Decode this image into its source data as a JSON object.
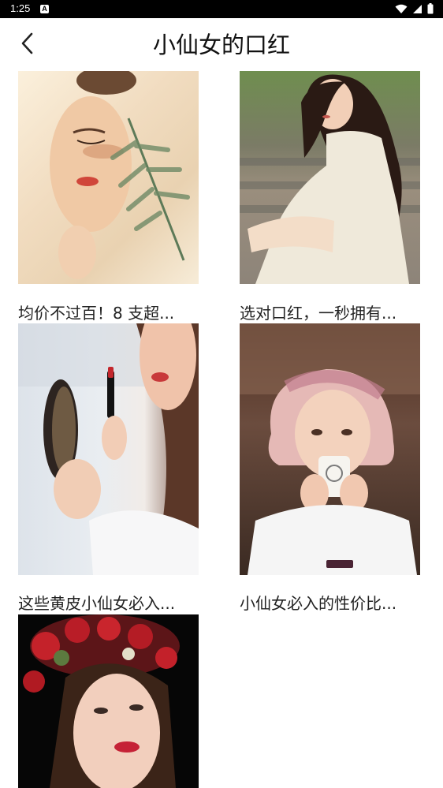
{
  "status_bar": {
    "time": "1:25",
    "notification_icon": "a-letter-icon",
    "icons": [
      "wifi-icon",
      "signal-icon",
      "battery-icon"
    ]
  },
  "header": {
    "back_icon": "chevron-left-icon",
    "title": "小仙女的口红"
  },
  "cards": [
    {
      "caption": "均价不过百！8 支超..."
    },
    {
      "caption": "选对口红，一秒拥有..."
    },
    {
      "caption": "这些黄皮小仙女必入..."
    },
    {
      "caption": "小仙女必入的性价比..."
    },
    {
      "caption": ""
    }
  ],
  "colors": {
    "status_bar_bg": "#000000",
    "page_bg": "#ffffff",
    "title_text": "#111111",
    "caption_text": "#222222"
  }
}
